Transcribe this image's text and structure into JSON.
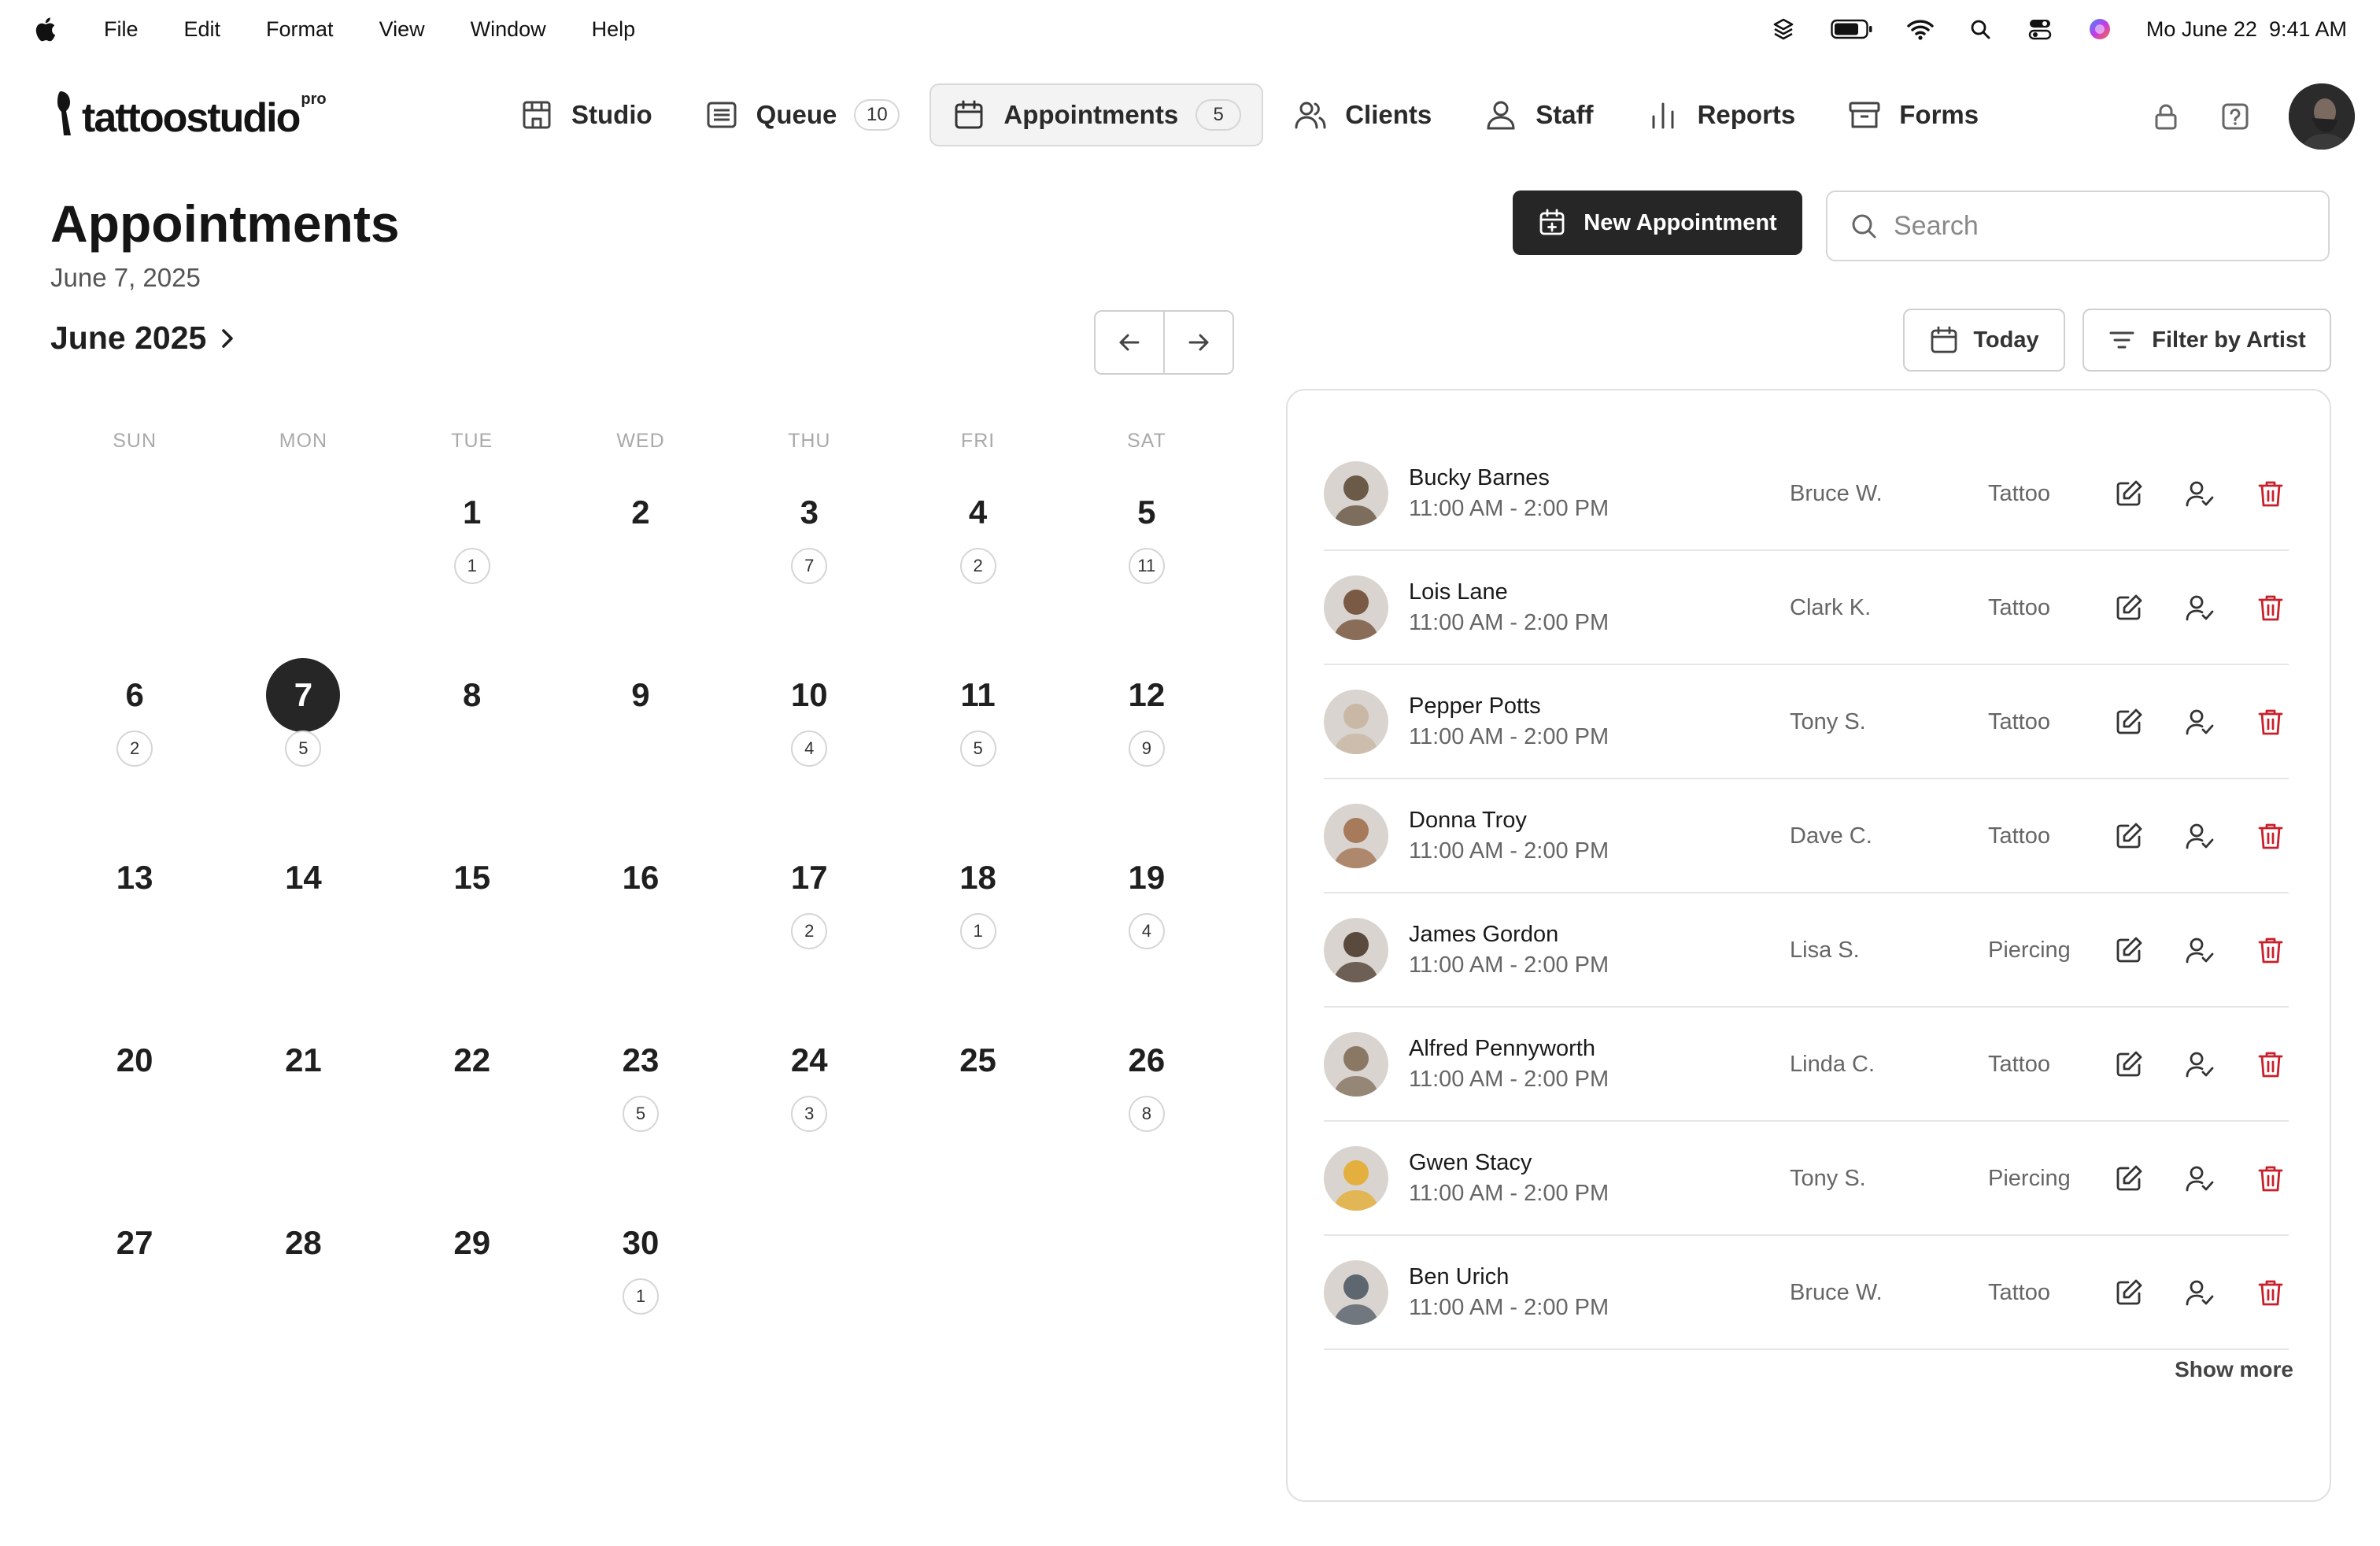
{
  "menubar": {
    "items": [
      "File",
      "Edit",
      "Format",
      "View",
      "Window",
      "Help"
    ],
    "datetime": "Mo June 22  9:41 AM"
  },
  "logo": {
    "wordmark": "tattoostudio",
    "tier": "pro"
  },
  "nav": [
    {
      "label": "Studio",
      "icon": "store-icon"
    },
    {
      "label": "Queue",
      "icon": "list-icon",
      "badge": "10"
    },
    {
      "label": "Appointments",
      "icon": "calendar-icon",
      "badge": "5",
      "active": true
    },
    {
      "label": "Clients",
      "icon": "users-icon"
    },
    {
      "label": "Staff",
      "icon": "staff-icon"
    },
    {
      "label": "Reports",
      "icon": "bar-chart-icon"
    },
    {
      "label": "Forms",
      "icon": "archive-icon"
    }
  ],
  "page": {
    "title": "Appointments",
    "date": "June 7, 2025"
  },
  "actions": {
    "new_label": "New Appointment",
    "search_placeholder": "Search",
    "today_label": "Today",
    "filter_label": "Filter by Artist"
  },
  "calendar": {
    "month_label": "June 2025",
    "weekdays": [
      "SUN",
      "MON",
      "TUE",
      "WED",
      "THU",
      "FRI",
      "SAT"
    ],
    "selected": 7,
    "weeks": [
      [
        null,
        null,
        {
          "d": "1",
          "c": "1"
        },
        {
          "d": "2"
        },
        {
          "d": "3",
          "c": "7"
        },
        {
          "d": "4",
          "c": "2"
        },
        {
          "d": "5",
          "c": "11"
        }
      ],
      [
        {
          "d": "6",
          "c": "2"
        },
        {
          "d": "7",
          "c": "5"
        },
        {
          "d": "8"
        },
        {
          "d": "9"
        },
        {
          "d": "10",
          "c": "4"
        },
        {
          "d": "11",
          "c": "5"
        },
        {
          "d": "12",
          "c": "9"
        }
      ],
      [
        {
          "d": "13"
        },
        {
          "d": "14"
        },
        {
          "d": "15"
        },
        {
          "d": "16"
        },
        {
          "d": "17",
          "c": "2"
        },
        {
          "d": "18",
          "c": "1"
        },
        {
          "d": "19",
          "c": "4"
        }
      ],
      [
        {
          "d": "20"
        },
        {
          "d": "21"
        },
        {
          "d": "22"
        },
        {
          "d": "23",
          "c": "5"
        },
        {
          "d": "24",
          "c": "3"
        },
        {
          "d": "25"
        },
        {
          "d": "26",
          "c": "8"
        }
      ],
      [
        {
          "d": "27"
        },
        {
          "d": "28"
        },
        {
          "d": "29"
        },
        {
          "d": "30",
          "c": "1"
        },
        null,
        null,
        null
      ]
    ]
  },
  "appointments": [
    {
      "name": "Bucky Barnes",
      "time": "11:00 AM - 2:00 PM",
      "artist": "Bruce W.",
      "service": "Tattoo",
      "color": "#6b5a48"
    },
    {
      "name": "Lois Lane",
      "time": "11:00 AM - 2:00 PM",
      "artist": "Clark K.",
      "service": "Tattoo",
      "color": "#7a5a44"
    },
    {
      "name": "Pepper Potts",
      "time": "11:00 AM - 2:00 PM",
      "artist": "Tony S.",
      "service": "Tattoo",
      "color": "#c9b8a6"
    },
    {
      "name": "Donna Troy",
      "time": "11:00 AM - 2:00 PM",
      "artist": "Dave C.",
      "service": "Tattoo",
      "color": "#a67a5b"
    },
    {
      "name": "James Gordon",
      "time": "11:00 AM - 2:00 PM",
      "artist": "Lisa S.",
      "service": "Piercing",
      "color": "#5a4a3e"
    },
    {
      "name": "Alfred Pennyworth",
      "time": "11:00 AM - 2:00 PM",
      "artist": "Linda C.",
      "service": "Tattoo",
      "color": "#8a7865"
    },
    {
      "name": "Gwen Stacy",
      "time": "11:00 AM - 2:00 PM",
      "artist": "Tony S.",
      "service": "Piercing",
      "color": "#e3b040"
    },
    {
      "name": "Ben Urich",
      "time": "11:00 AM - 2:00 PM",
      "artist": "Bruce W.",
      "service": "Tattoo",
      "color": "#5e6670"
    }
  ],
  "show_more_label": "Show more",
  "colors": {
    "accent": "#262626",
    "danger": "#c8202a",
    "border": "#d6d6d6"
  }
}
